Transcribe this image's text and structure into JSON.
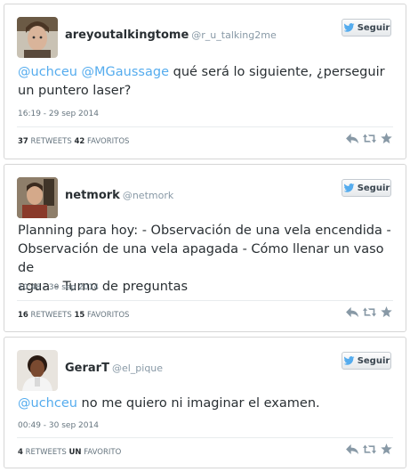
{
  "follow_label": "Seguir",
  "tweets": [
    {
      "display_name": "areyoutalkingtome",
      "handle": "@r_u_talking2me",
      "mention1": "@uchceu",
      "mention2": "@MGaussage",
      "text_line1_rest": " qué será lo siguiente, ¿perseguir",
      "text_line2": "un puntero laser?",
      "timestamp": "16:19 - 29 sep 2014",
      "retweets_count": "37",
      "retweets_label": "RETWEETS",
      "favorites_count": "42",
      "favorites_label": "FAVORITOS"
    },
    {
      "display_name": "netmork",
      "handle": "@netmork",
      "text_line1": "Planning para hoy: - Observación de una vela encendida -",
      "text_line2": "Observación de una vela apagada - Cómo llenar un vaso de",
      "text_line3": "agua - Turno de preguntas",
      "timestamp": "10:48 - 30 sep 2014",
      "retweets_count": "16",
      "retweets_label": "RETWEETS",
      "favorites_count": "15",
      "favorites_label": "FAVORITOS"
    },
    {
      "display_name": "GerarT",
      "handle": "@el_pique",
      "mention1": "@uchceu",
      "text_line1_rest": " no me quiero ni imaginar el examen.",
      "timestamp": "00:49 - 30 sep 2014",
      "retweets_count": "4",
      "retweets_label": "RETWEETS",
      "favorites_count": "UN",
      "favorites_label": "FAVORITO"
    }
  ],
  "colors": {
    "link": "#55acee",
    "text": "#292f33",
    "meta": "#66757f",
    "handle": "#8899a6",
    "action_icon": "#8899a6",
    "border": "#d6d6d6"
  },
  "icons": [
    "twitter-bird-icon",
    "reply-icon",
    "retweet-icon",
    "favorite-star-icon"
  ]
}
